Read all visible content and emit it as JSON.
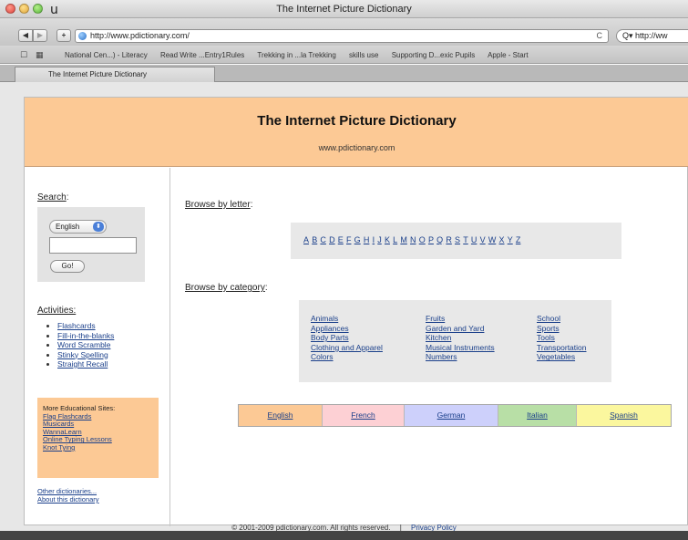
{
  "window": {
    "title": "The Internet Picture Dictionary",
    "corner_glyph": "u"
  },
  "toolbar": {
    "back": "◀",
    "forward": "▶",
    "add": "+",
    "url": "http://www.pdictionary.com/",
    "reload": "C",
    "search_value": "Q▾ http://ww"
  },
  "bookmarks": {
    "items": [
      "National Cen...) - Literacy",
      "Read Write ...Entry1Rules",
      "Trekking in ...la Trekking",
      "skills use",
      "Supporting D...exic Pupils",
      "Apple - Start"
    ]
  },
  "tab": {
    "label": "The Internet Picture Dictionary"
  },
  "header": {
    "title": "The Internet Picture Dictionary",
    "url": "www.pdictionary.com"
  },
  "sidebar": {
    "search_label": "Search",
    "search_colon": ":",
    "language_value": "English",
    "go_label": "Go!",
    "activities_label": "Activities:",
    "activities": [
      "Flashcards",
      "Fill-in-the-blanks",
      "Word Scramble",
      "Stinky Spelling",
      "Straight Recall"
    ],
    "edu_title": "More Educational Sites:",
    "edu_links": [
      "Flag Flashcards",
      "Musicards",
      "WannaLearn",
      "Online Typing Lessons",
      "Knot Tying"
    ],
    "other_links": [
      "Other dictionaries...",
      "About this dictionary"
    ]
  },
  "content": {
    "browse_letter_label": "Browse by letter",
    "browse_letter_colon": ":",
    "letters": [
      "A",
      "B",
      "C",
      "D",
      "E",
      "F",
      "G",
      "H",
      "I",
      "J",
      "K",
      "L",
      "M",
      "N",
      "O",
      "P",
      "Q",
      "R",
      "S",
      "T",
      "U",
      "V",
      "W",
      "X",
      "Y",
      "Z"
    ],
    "browse_category_label": "Browse by category",
    "browse_category_colon": ":",
    "categories": [
      [
        "Animals",
        "Appliances",
        "Body Parts",
        "Clothing and Apparel",
        "Colors"
      ],
      [
        "Fruits",
        "Garden and Yard",
        "Kitchen",
        "Musical Instruments",
        "Numbers"
      ],
      [
        "School",
        "Sports",
        "Tools",
        "Transportation",
        "Vegetables"
      ]
    ],
    "languages": [
      {
        "label": "English",
        "color": "#fcc995"
      },
      {
        "label": "French",
        "color": "#fdd0d4"
      },
      {
        "label": "German",
        "color": "#cdd0fb"
      },
      {
        "label": "Italian",
        "color": "#b8dfa6"
      },
      {
        "label": "Spanish",
        "color": "#fbf79e"
      }
    ]
  },
  "footer": {
    "copyright": "© 2001-2009 pdictionary.com. All rights reserved.",
    "separator": "|",
    "privacy": "Privacy Policy"
  },
  "colors": {
    "header_bg": "#fcc995",
    "link": "#1a3f8a",
    "panel_gray": "#e8e8e8"
  }
}
